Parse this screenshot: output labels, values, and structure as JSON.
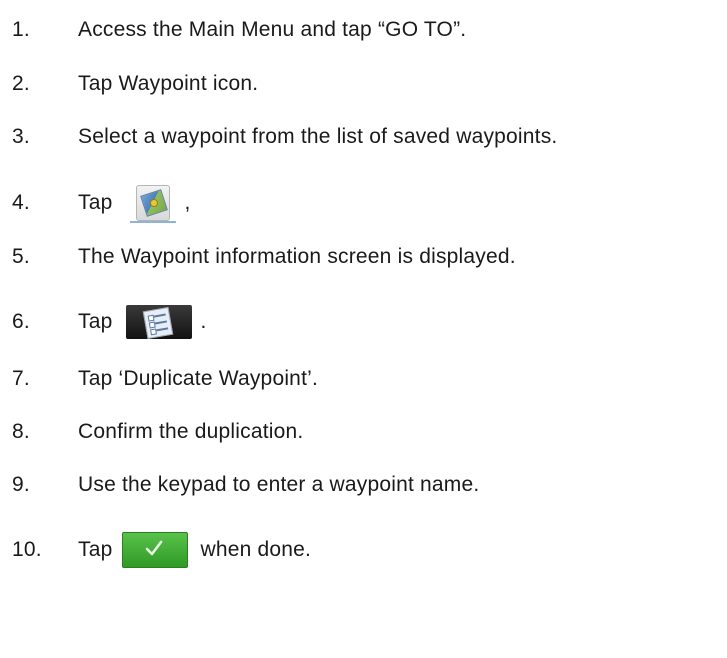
{
  "steps": [
    {
      "num": "1.",
      "text": "Access the Main Menu and tap “GO TO”."
    },
    {
      "num": "2.",
      "text": "Tap Waypoint icon."
    },
    {
      "num": "3.",
      "text": "Select a waypoint from the list of saved waypoints."
    },
    {
      "num": "4.",
      "text_before": "Tap",
      "text_after": ",",
      "icon": "waypoint-details-icon"
    },
    {
      "num": "5.",
      "text": "The Waypoint information screen is displayed."
    },
    {
      "num": "6.",
      "text_before": "Tap",
      "text_after": ".",
      "icon": "menu-list-icon"
    },
    {
      "num": "7.",
      "text": "Tap ‘Duplicate Waypoint’."
    },
    {
      "num": "8.",
      "text": "Confirm the duplication."
    },
    {
      "num": "9.",
      "text": "Use the keypad to enter a waypoint name."
    },
    {
      "num": "10.",
      "text_before": "Tap",
      "text_after": "when done.",
      "icon": "confirm-check-icon"
    }
  ],
  "colors": {
    "text": "#1a1a1a",
    "confirm_green": "#3aa62f",
    "menu_dark": "#1e1e1e"
  }
}
